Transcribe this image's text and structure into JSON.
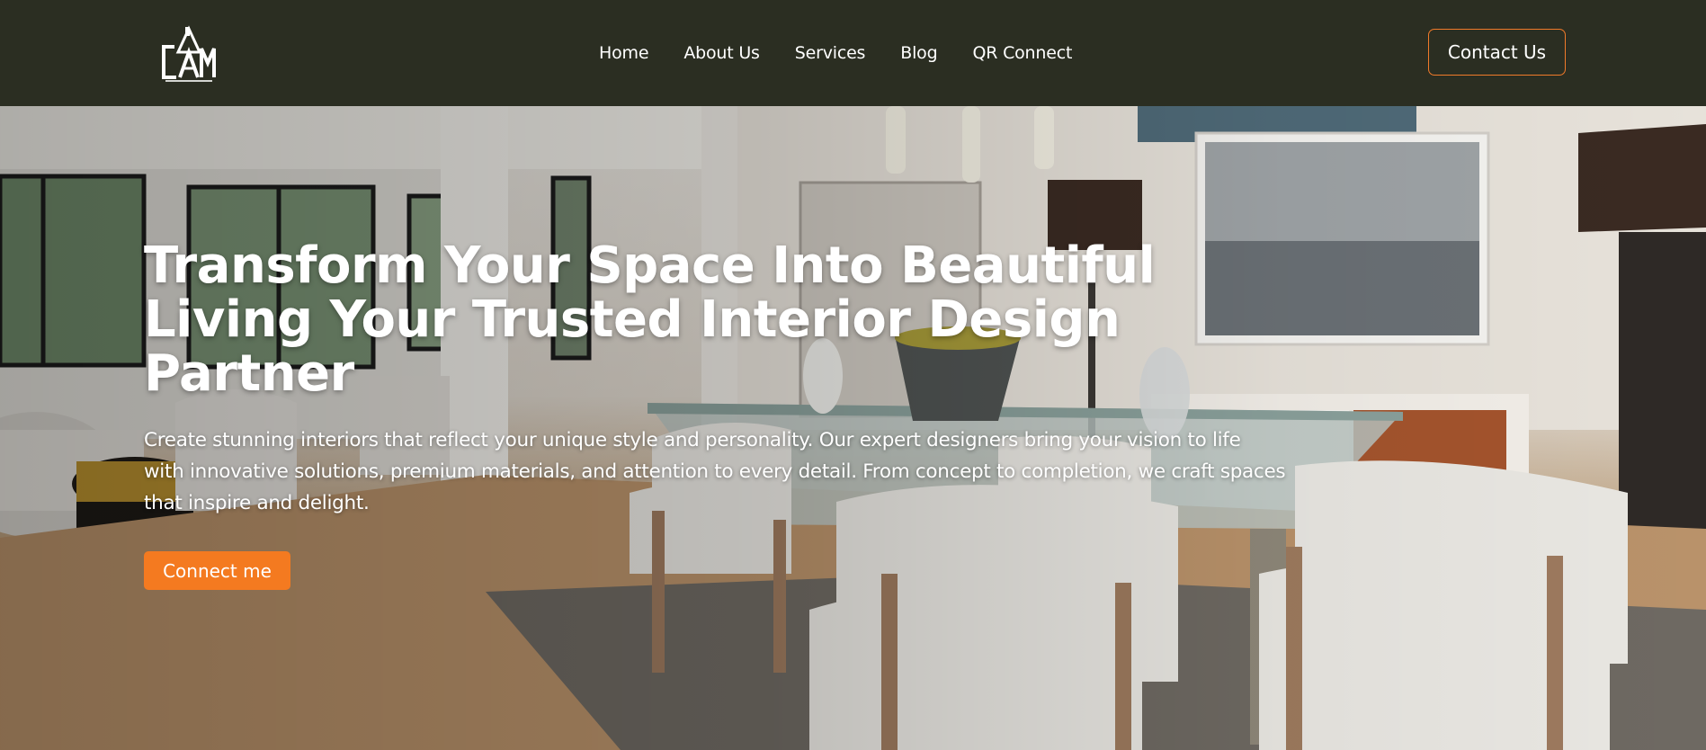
{
  "header": {
    "logo": {
      "icon": "house-monogram-logo",
      "text": "CAM",
      "tagline": "Architects & Interiors"
    },
    "nav": [
      {
        "label": "Home"
      },
      {
        "label": "About Us"
      },
      {
        "label": "Services"
      },
      {
        "label": "Blog"
      },
      {
        "label": "QR Connect"
      }
    ],
    "contact_label": "Contact Us"
  },
  "hero": {
    "title": "Transform Your Space Into Beautiful Living Your Trusted Interior Design Partner",
    "description": "Create stunning interiors that reflect your unique style and personality. Our expert designers bring your vision to life with innovative solutions, premium materials, and attention to every detail. From concept to completion, we craft spaces that inspire and delight.",
    "cta_label": "Connect me",
    "background": "interior-dining-room-photo"
  },
  "colors": {
    "header_bg": "#2b2e22",
    "accent": "#f47a20",
    "text": "#ffffff"
  }
}
